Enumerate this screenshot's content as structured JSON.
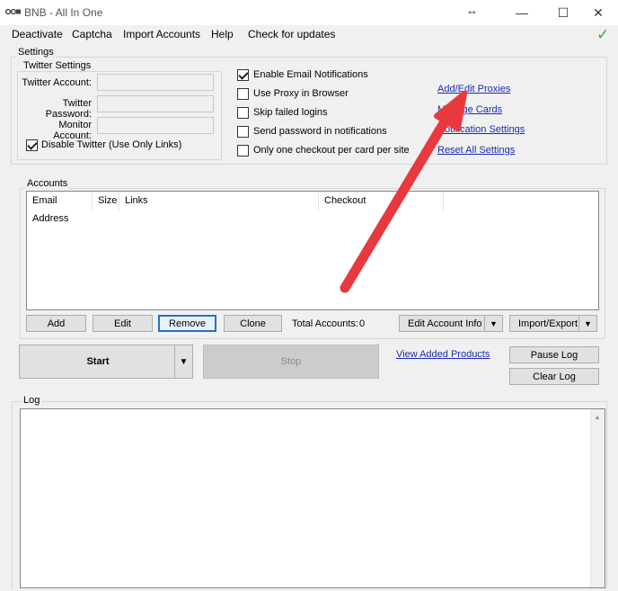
{
  "window": {
    "title": "BNB - All In One",
    "minimize_glyph": "—",
    "maximize_glyph": "☐",
    "close_glyph": "✕",
    "resize_glyph": "↔"
  },
  "menu": {
    "items": [
      "Deactivate",
      "Captcha",
      "Import Accounts",
      "Help",
      "Check for updates"
    ],
    "status_icon": "check-icon",
    "status_glyph": "✓"
  },
  "settings": {
    "group_label": "Settings",
    "twitter": {
      "group_label": "Twitter Settings",
      "account_label": "Twitter Account:",
      "password_label": "Twitter Password:",
      "monitor_label": "Monitor Account:",
      "account_value": "",
      "password_value": "",
      "monitor_value": "",
      "disable_label": "Disable Twitter (Use Only Links)",
      "disable_checked": true
    },
    "options": [
      {
        "label": "Enable Email Notifications",
        "checked": true
      },
      {
        "label": "Use Proxy in Browser",
        "checked": false
      },
      {
        "label": "Skip failed logins",
        "checked": false
      },
      {
        "label": "Send password in notifications",
        "checked": false
      },
      {
        "label": "Only one checkout per card per site",
        "checked": false
      }
    ],
    "links": [
      "Add/Edit Proxies",
      "Manage Cards",
      "Notification Settings",
      "Reset All Settings"
    ]
  },
  "accounts": {
    "group_label": "Accounts",
    "columns": [
      "Email Address",
      "Size",
      "Links",
      "Checkout"
    ],
    "rows": [],
    "buttons": {
      "add": "Add",
      "edit": "Edit",
      "remove": "Remove",
      "clone": "Clone",
      "edit_account_info": "Edit Account Info",
      "import_export": "Import/Export"
    },
    "total_label": "Total Accounts:",
    "total_value": "0"
  },
  "controls": {
    "start": "Start",
    "stop": "Stop",
    "view_added_products": "View Added Products",
    "pause_log": "Pause Log",
    "clear_log": "Clear Log"
  },
  "log": {
    "group_label": "Log",
    "content": ""
  },
  "colors": {
    "link": "#1a2bb3",
    "annotation_arrow": "#e8393e",
    "status_ok": "#3aa43a"
  }
}
